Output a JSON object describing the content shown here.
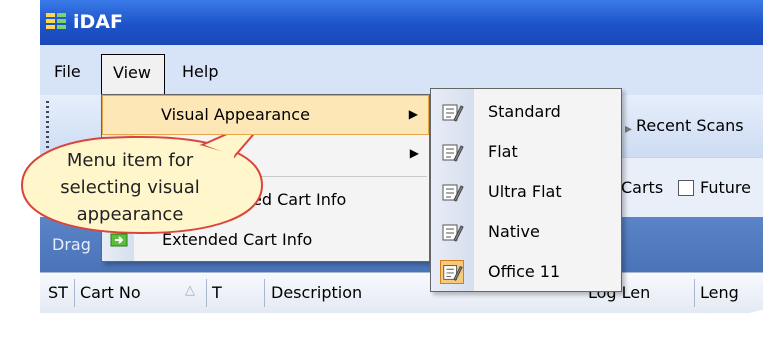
{
  "window": {
    "title": "iDAF"
  },
  "menubar": {
    "file": "File",
    "view": "View",
    "help": "Help"
  },
  "toolbar": {
    "recent_scans": "Recent Scans"
  },
  "options": {
    "carts_label": "Carts",
    "future_label": "Future"
  },
  "dragbar": {
    "text": "Drag"
  },
  "grid": {
    "columns": [
      "ST",
      "Cart No",
      "T",
      "Description",
      "Log Len",
      "Leng"
    ]
  },
  "view_menu": {
    "items": [
      {
        "label": "Visual Appearance",
        "has_submenu": true
      },
      {
        "label": "",
        "has_submenu": true
      },
      {
        "label": "ed Cart Info"
      },
      {
        "label": "Extended Cart Info"
      }
    ]
  },
  "visual_appearance_menu": {
    "items": [
      "Standard",
      "Flat",
      "Ultra Flat",
      "Native",
      "Office 11"
    ],
    "selected": "Office 11"
  },
  "callout": {
    "text": "Menu item for selecting visual appearance"
  },
  "colors": {
    "titlebar": "#1d53c9",
    "highlight": "#fde7b6",
    "callout_fill": "#fff6cc",
    "callout_border": "#d9453a"
  }
}
